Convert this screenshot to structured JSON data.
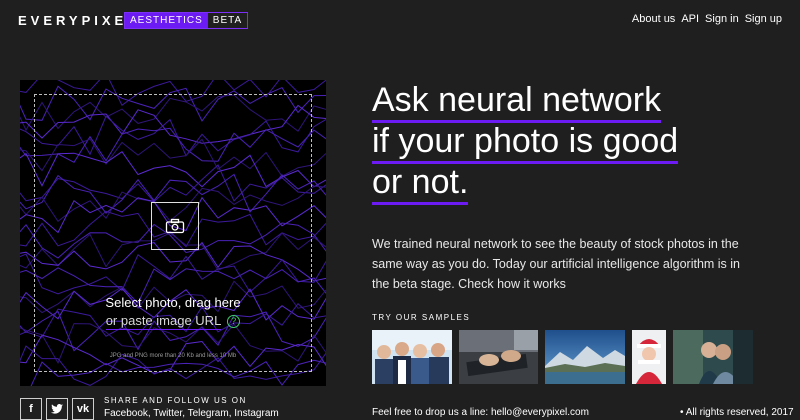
{
  "header": {
    "logo": "EVERYPIXEL",
    "badge_main": "AESTHETICS",
    "badge_beta": "BETA",
    "nav": [
      "About us",
      "API",
      "Sign in",
      "Sign up"
    ]
  },
  "upload": {
    "select_text": "Select photo, drag here",
    "paste_text": "or paste image URL",
    "help_symbol": "?",
    "note": "JPG and PNG more than 20 Kb and less 10 Mb"
  },
  "headline": {
    "line1": "Ask neural network",
    "line2": "if your photo is good",
    "line3": "or not."
  },
  "description": "We trained neural network to see the beauty of stock photos in the same way as you do. Today our artificial intelligence algorithm is in the beta stage. Check how it works",
  "samples": {
    "title": "TRY OUR SAMPLES",
    "items": [
      "business-team-photo",
      "typing-hands-photo",
      "mountain-lake-photo",
      "woman-in-red-hat-photo",
      "couple-photo"
    ]
  },
  "footer": {
    "social_icons": [
      "f",
      "t",
      "vk"
    ],
    "share_title": "SHARE AND FOLLOW US ON",
    "share_links": "Facebook, Twitter, Telegram, Instagram",
    "contact": "Feel free to drop us a line: hello@everypixel.com",
    "rights": "All rights reserved, 2017"
  },
  "colors": {
    "accent": "#6c1cf2",
    "background": "#1f1f1f",
    "help_green": "#3ecf6a"
  }
}
